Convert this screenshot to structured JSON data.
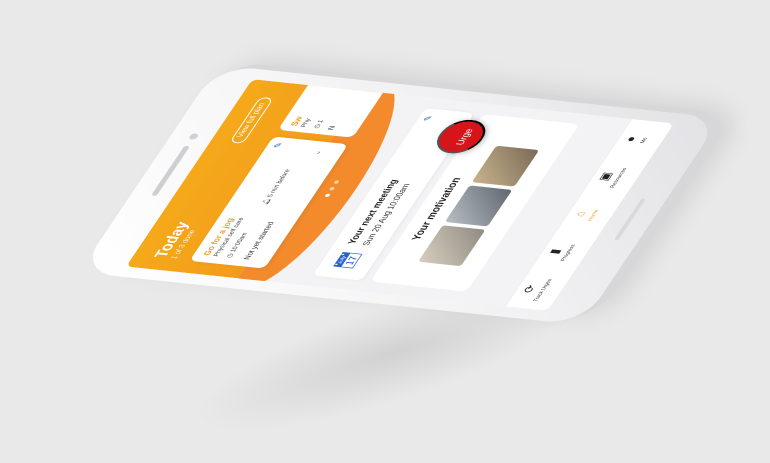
{
  "hero": {
    "title": "Today",
    "subtitle": "1 of 3 done",
    "view_plan": "View full plan"
  },
  "task_card": {
    "title": "Go for a jog",
    "category": "Physical self care",
    "time": "10:00am",
    "reminder": "5 min before",
    "status": "Not yet started"
  },
  "task_card_2": {
    "title": "Sw",
    "category": "Phy",
    "clock": "1",
    "letter": "N"
  },
  "carousel": {
    "count": 3,
    "active": 0
  },
  "meeting": {
    "title": "Your next meeting",
    "date": "Sun 20 Aug 10:00am"
  },
  "motivation": {
    "title": "Your motivation"
  },
  "urge_button": {
    "label": "Urge"
  },
  "tabbar": {
    "items": [
      {
        "label": "Track Urges",
        "icon": "refresh-icon"
      },
      {
        "label": "Progress",
        "icon": "bar-chart-icon"
      },
      {
        "label": "Home",
        "icon": "home-icon"
      },
      {
        "label": "Resources",
        "icon": "book-icon"
      },
      {
        "label": "Me",
        "icon": "person-icon"
      }
    ]
  },
  "colors": {
    "accent": "#f4a91a",
    "wave": "#f38b2d",
    "urge": "#d7141a",
    "link": "#2563c9"
  }
}
